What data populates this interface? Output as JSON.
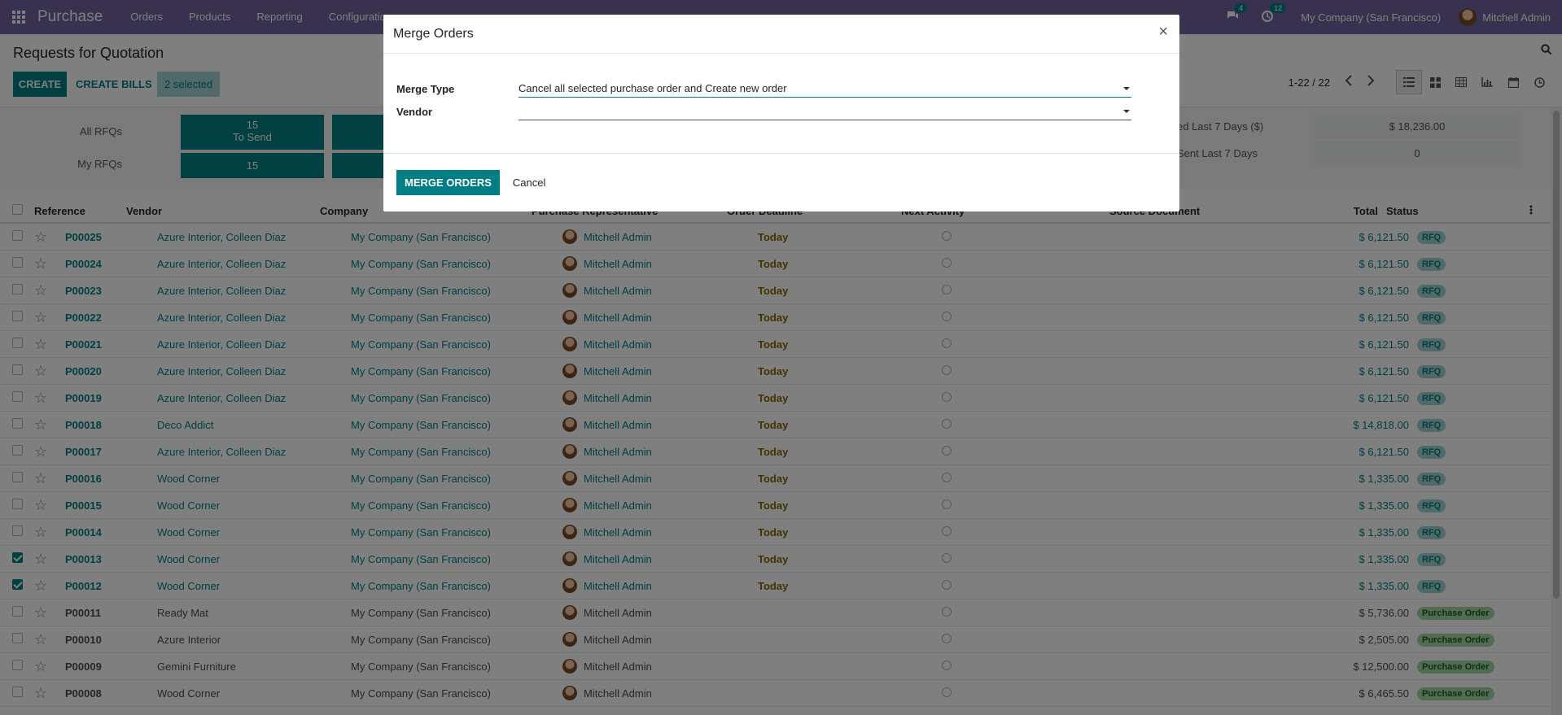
{
  "navbar": {
    "brand": "Purchase",
    "menus": [
      "Orders",
      "Products",
      "Reporting",
      "Configuration"
    ],
    "messages_count": "4",
    "activities_count": "12",
    "company": "My Company (San Francisco)",
    "user": "Mitchell Admin"
  },
  "control_panel": {
    "title": "Requests for Quotation",
    "create_label": "CREATE",
    "bills_label": "CREATE BILLS",
    "selected_label": "2 selected",
    "pager": "1-22 / 22"
  },
  "dashboard": {
    "all_rfqs_label": "All RFQs",
    "my_rfqs_label": "My RFQs",
    "to_send_count": "15",
    "to_send_label": "To Send",
    "my_to_send_count": "15",
    "stat1_label": "ed Last 7 Days ($)",
    "stat1_value": "$ 18,236.00",
    "stat2_label": "Sent Last 7 Days",
    "stat2_value": "0"
  },
  "table": {
    "headers": {
      "reference": "Reference",
      "vendor": "Vendor",
      "company": "Company",
      "rep": "Purchase Representative",
      "deadline": "Order Deadline",
      "activity": "Next Activity",
      "source": "Source Document",
      "total": "Total",
      "status": "Status"
    },
    "rows": [
      {
        "ref": "P00025",
        "vendor": "Azure Interior, Colleen Diaz",
        "company": "My Company (San Francisco)",
        "rep": "Mitchell Admin",
        "deadline": "Today",
        "total": "$ 6,121.50",
        "status": "RFQ",
        "checked": false
      },
      {
        "ref": "P00024",
        "vendor": "Azure Interior, Colleen Diaz",
        "company": "My Company (San Francisco)",
        "rep": "Mitchell Admin",
        "deadline": "Today",
        "total": "$ 6,121.50",
        "status": "RFQ",
        "checked": false
      },
      {
        "ref": "P00023",
        "vendor": "Azure Interior, Colleen Diaz",
        "company": "My Company (San Francisco)",
        "rep": "Mitchell Admin",
        "deadline": "Today",
        "total": "$ 6,121.50",
        "status": "RFQ",
        "checked": false
      },
      {
        "ref": "P00022",
        "vendor": "Azure Interior, Colleen Diaz",
        "company": "My Company (San Francisco)",
        "rep": "Mitchell Admin",
        "deadline": "Today",
        "total": "$ 6,121.50",
        "status": "RFQ",
        "checked": false
      },
      {
        "ref": "P00021",
        "vendor": "Azure Interior, Colleen Diaz",
        "company": "My Company (San Francisco)",
        "rep": "Mitchell Admin",
        "deadline": "Today",
        "total": "$ 6,121.50",
        "status": "RFQ",
        "checked": false
      },
      {
        "ref": "P00020",
        "vendor": "Azure Interior, Colleen Diaz",
        "company": "My Company (San Francisco)",
        "rep": "Mitchell Admin",
        "deadline": "Today",
        "total": "$ 6,121.50",
        "status": "RFQ",
        "checked": false
      },
      {
        "ref": "P00019",
        "vendor": "Azure Interior, Colleen Diaz",
        "company": "My Company (San Francisco)",
        "rep": "Mitchell Admin",
        "deadline": "Today",
        "total": "$ 6,121.50",
        "status": "RFQ",
        "checked": false
      },
      {
        "ref": "P00018",
        "vendor": "Deco Addict",
        "company": "My Company (San Francisco)",
        "rep": "Mitchell Admin",
        "deadline": "Today",
        "total": "$ 14,818.00",
        "status": "RFQ",
        "checked": false
      },
      {
        "ref": "P00017",
        "vendor": "Azure Interior, Colleen Diaz",
        "company": "My Company (San Francisco)",
        "rep": "Mitchell Admin",
        "deadline": "Today",
        "total": "$ 6,121.50",
        "status": "RFQ",
        "checked": false
      },
      {
        "ref": "P00016",
        "vendor": "Wood Corner",
        "company": "My Company (San Francisco)",
        "rep": "Mitchell Admin",
        "deadline": "Today",
        "total": "$ 1,335.00",
        "status": "RFQ",
        "checked": false
      },
      {
        "ref": "P00015",
        "vendor": "Wood Corner",
        "company": "My Company (San Francisco)",
        "rep": "Mitchell Admin",
        "deadline": "Today",
        "total": "$ 1,335.00",
        "status": "RFQ",
        "checked": false
      },
      {
        "ref": "P00014",
        "vendor": "Wood Corner",
        "company": "My Company (San Francisco)",
        "rep": "Mitchell Admin",
        "deadline": "Today",
        "total": "$ 1,335.00",
        "status": "RFQ",
        "checked": false
      },
      {
        "ref": "P00013",
        "vendor": "Wood Corner",
        "company": "My Company (San Francisco)",
        "rep": "Mitchell Admin",
        "deadline": "Today",
        "total": "$ 1,335.00",
        "status": "RFQ",
        "checked": true
      },
      {
        "ref": "P00012",
        "vendor": "Wood Corner",
        "company": "My Company (San Francisco)",
        "rep": "Mitchell Admin",
        "deadline": "Today",
        "total": "$ 1,335.00",
        "status": "RFQ",
        "checked": true
      },
      {
        "ref": "P00011",
        "vendor": "Ready Mat",
        "company": "My Company (San Francisco)",
        "rep": "Mitchell Admin",
        "deadline": "",
        "total": "$ 5,736.00",
        "status": "Purchase Order",
        "checked": false
      },
      {
        "ref": "P00010",
        "vendor": "Azure Interior",
        "company": "My Company (San Francisco)",
        "rep": "Mitchell Admin",
        "deadline": "",
        "total": "$ 2,505.00",
        "status": "Purchase Order",
        "checked": false
      },
      {
        "ref": "P00009",
        "vendor": "Gemini Furniture",
        "company": "My Company (San Francisco)",
        "rep": "Mitchell Admin",
        "deadline": "",
        "total": "$ 12,500.00",
        "status": "Purchase Order",
        "checked": false
      },
      {
        "ref": "P00008",
        "vendor": "Wood Corner",
        "company": "My Company (San Francisco)",
        "rep": "Mitchell Admin",
        "deadline": "",
        "total": "$ 6,465.50",
        "status": "Purchase Order",
        "checked": false
      }
    ]
  },
  "modal": {
    "title": "Merge Orders",
    "close": "×",
    "merge_type_label": "Merge Type",
    "merge_type_value": "Cancel all selected purchase order and Create new order",
    "vendor_label": "Vendor",
    "vendor_value": "",
    "merge_button": "MERGE ORDERS",
    "cancel_button": "Cancel"
  },
  "colors": {
    "navbar": "#71639e",
    "primary": "#017e84",
    "rfq_badge": "#a5d3d5",
    "po_badge": "#a3d9a5",
    "today": "#856404"
  }
}
